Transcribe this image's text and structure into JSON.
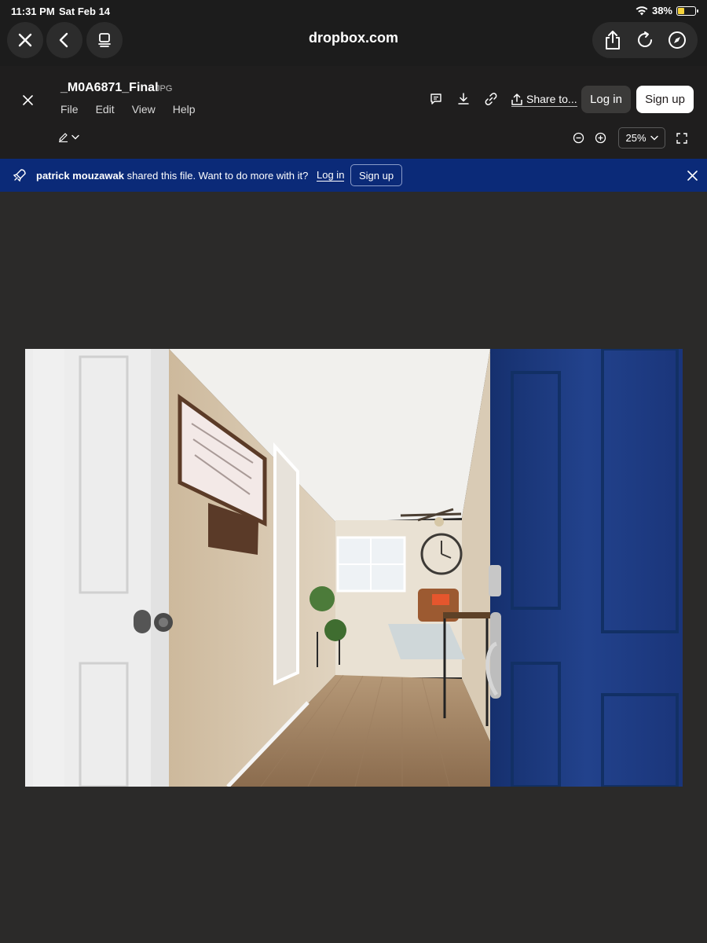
{
  "status_bar": {
    "time": "11:31 PM",
    "date": "Sat Feb 14",
    "battery": "38%"
  },
  "browser": {
    "url": "dropbox.com"
  },
  "file": {
    "name": "_M0A6871_Final",
    "type": "JPG"
  },
  "menu": [
    "File",
    "Edit",
    "View",
    "Help"
  ],
  "toolbar": {
    "share_label": "Share to...",
    "login_label": "Log in",
    "signup_label": "Sign up",
    "zoom": "25%"
  },
  "banner": {
    "user": "patrick mouzawak",
    "message": "shared this file. Want to do more with it?",
    "login_label": "Log in",
    "signup_label": "Sign up"
  },
  "colors": {
    "banner_bg": "#0b2a78",
    "header_bg": "#1f1e1e",
    "canvas_bg": "#2b2a29",
    "door_blue": "#1c3a7e"
  },
  "icons": {
    "close": "close-icon",
    "back": "chevron-left-icon",
    "tabs": "tabs-icon",
    "share": "share-icon",
    "reload": "reload-icon",
    "compass": "compass-icon",
    "comment": "comment-icon",
    "download": "download-icon",
    "link": "link-icon",
    "pen": "pen-icon",
    "rocket": "rocket-icon"
  }
}
